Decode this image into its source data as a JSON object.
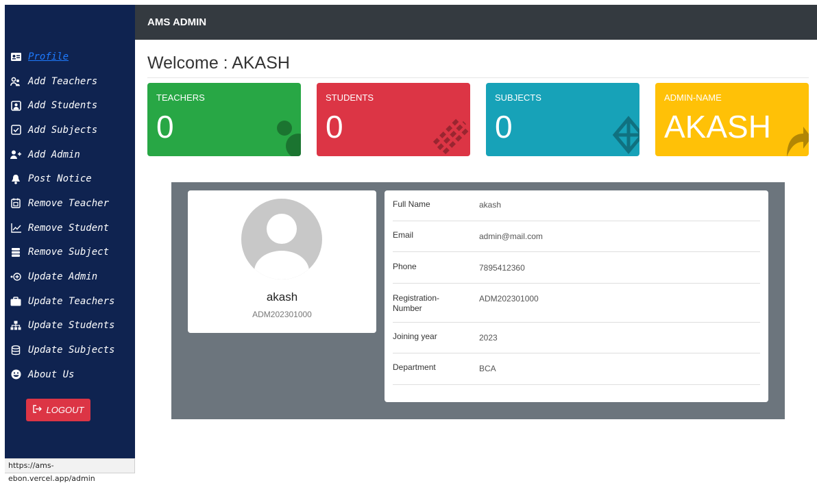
{
  "topbar": {
    "brand": "AMS ADMIN"
  },
  "sidebar": {
    "items": [
      {
        "label": "Profile",
        "icon": "id-card-icon",
        "active": true
      },
      {
        "label": "Add Teachers",
        "icon": "users-icon"
      },
      {
        "label": "Add Students",
        "icon": "person-square-icon"
      },
      {
        "label": "Add Subjects",
        "icon": "check-square-icon"
      },
      {
        "label": "Add Admin",
        "icon": "user-plus-icon"
      },
      {
        "label": "Post Notice",
        "icon": "bell-icon"
      },
      {
        "label": "Remove Teacher",
        "icon": "calendar-icon"
      },
      {
        "label": "Remove Student",
        "icon": "chart-line-icon"
      },
      {
        "label": "Remove Subject",
        "icon": "server-icon"
      },
      {
        "label": "Update Admin",
        "icon": "dot-plus-icon"
      },
      {
        "label": "Update Teachers",
        "icon": "briefcase-icon"
      },
      {
        "label": "Update Students",
        "icon": "sitemap-icon"
      },
      {
        "label": "Update Subjects",
        "icon": "database-icon"
      },
      {
        "label": "About Us",
        "icon": "smile-icon"
      }
    ],
    "logout_label": "LOGOUT"
  },
  "statusbar": {
    "url": "https://ams-ebon.vercel.app/admin"
  },
  "welcome": "Welcome : AKASH",
  "cards": [
    {
      "label": "TEACHERS",
      "value": "0",
      "color": "#28a745",
      "icon": "users-icon"
    },
    {
      "label": "STUDENTS",
      "value": "0",
      "color": "#dc3545",
      "icon": "pen-icon"
    },
    {
      "label": "SUBJECTS",
      "value": "0",
      "color": "#17a2b8",
      "icon": "cube-icon"
    },
    {
      "label": "ADMIN-NAME",
      "value": "AKASH",
      "color": "#ffc107",
      "icon": "share-icon"
    }
  ],
  "profile": {
    "name": "akash",
    "reg": "ADM202301000",
    "details": [
      {
        "key": "Full Name",
        "value": "akash"
      },
      {
        "key": "Email",
        "value": "admin@mail.com"
      },
      {
        "key": "Phone",
        "value": "7895412360"
      },
      {
        "key": "Registration-Number",
        "value": "ADM202301000"
      },
      {
        "key": "Joining year",
        "value": "2023"
      },
      {
        "key": "Department",
        "value": "BCA"
      }
    ]
  }
}
